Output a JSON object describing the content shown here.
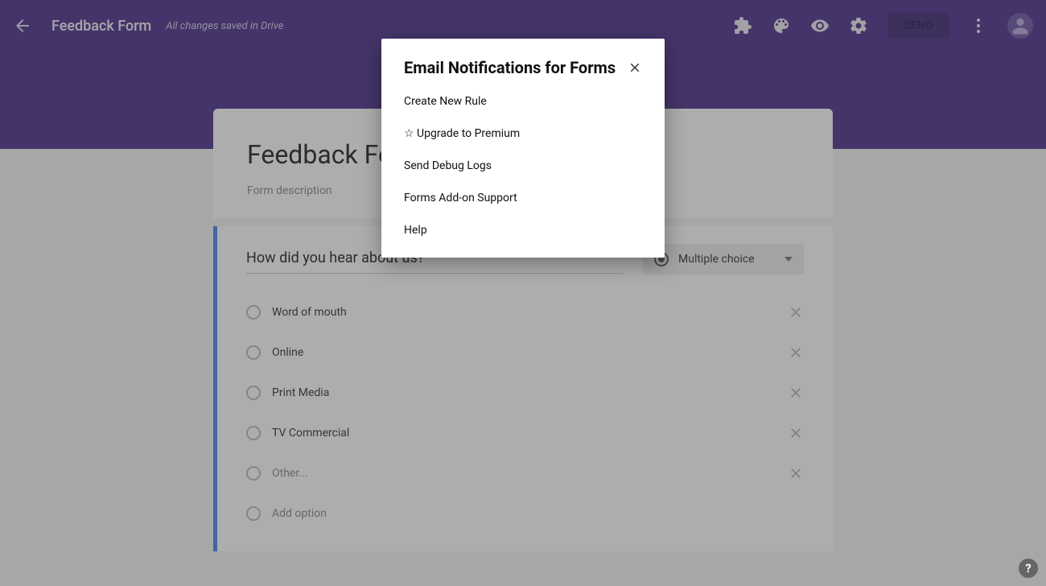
{
  "header": {
    "doc_title": "Feedback Form",
    "save_status": "All changes saved in Drive",
    "send_label": "SEND"
  },
  "form": {
    "title": "Feedback Form",
    "description": "Form description"
  },
  "question": {
    "title": "How did you hear about us?",
    "type_label": "Multiple choice",
    "options": [
      {
        "label": "Word of mouth",
        "faded": false
      },
      {
        "label": "Online",
        "faded": false
      },
      {
        "label": "Print Media",
        "faded": false
      },
      {
        "label": "TV Commercial",
        "faded": false
      },
      {
        "label": "Other...",
        "faded": true
      }
    ],
    "add_option_label": "Add option"
  },
  "popup": {
    "title": "Email Notifications for Forms",
    "items": [
      "Create New Rule",
      "☆ Upgrade to Premium",
      "Send Debug Logs",
      "Forms Add-on Support",
      "Help"
    ]
  },
  "help_fab": "?"
}
